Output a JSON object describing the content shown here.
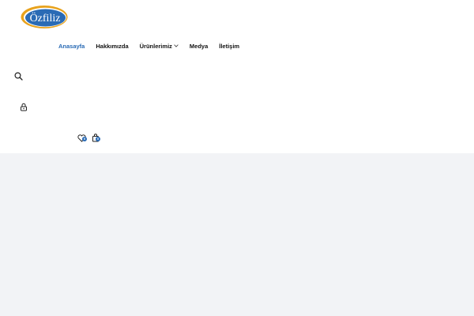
{
  "brand": {
    "logo_text": "Özfiliz"
  },
  "nav": {
    "items": [
      {
        "label": "Anasayfa",
        "active": true
      },
      {
        "label": "Hakkımızda",
        "active": false
      },
      {
        "label": "Ürünlerimiz",
        "active": false,
        "has_dropdown": true
      },
      {
        "label": "Medya",
        "active": false
      },
      {
        "label": "İletişim",
        "active": false
      }
    ]
  },
  "actions": {
    "search_icon": "search-icon",
    "account_icon": "lock-icon",
    "wishlist_icon": "heart-icon",
    "wishlist_count": "0",
    "cart_icon": "shopping-bag-icon",
    "cart_count": "0"
  },
  "colors": {
    "accent": "#2a6bb5",
    "logo_ring": "#e8a21c",
    "content_bg": "#f2f3f6"
  }
}
